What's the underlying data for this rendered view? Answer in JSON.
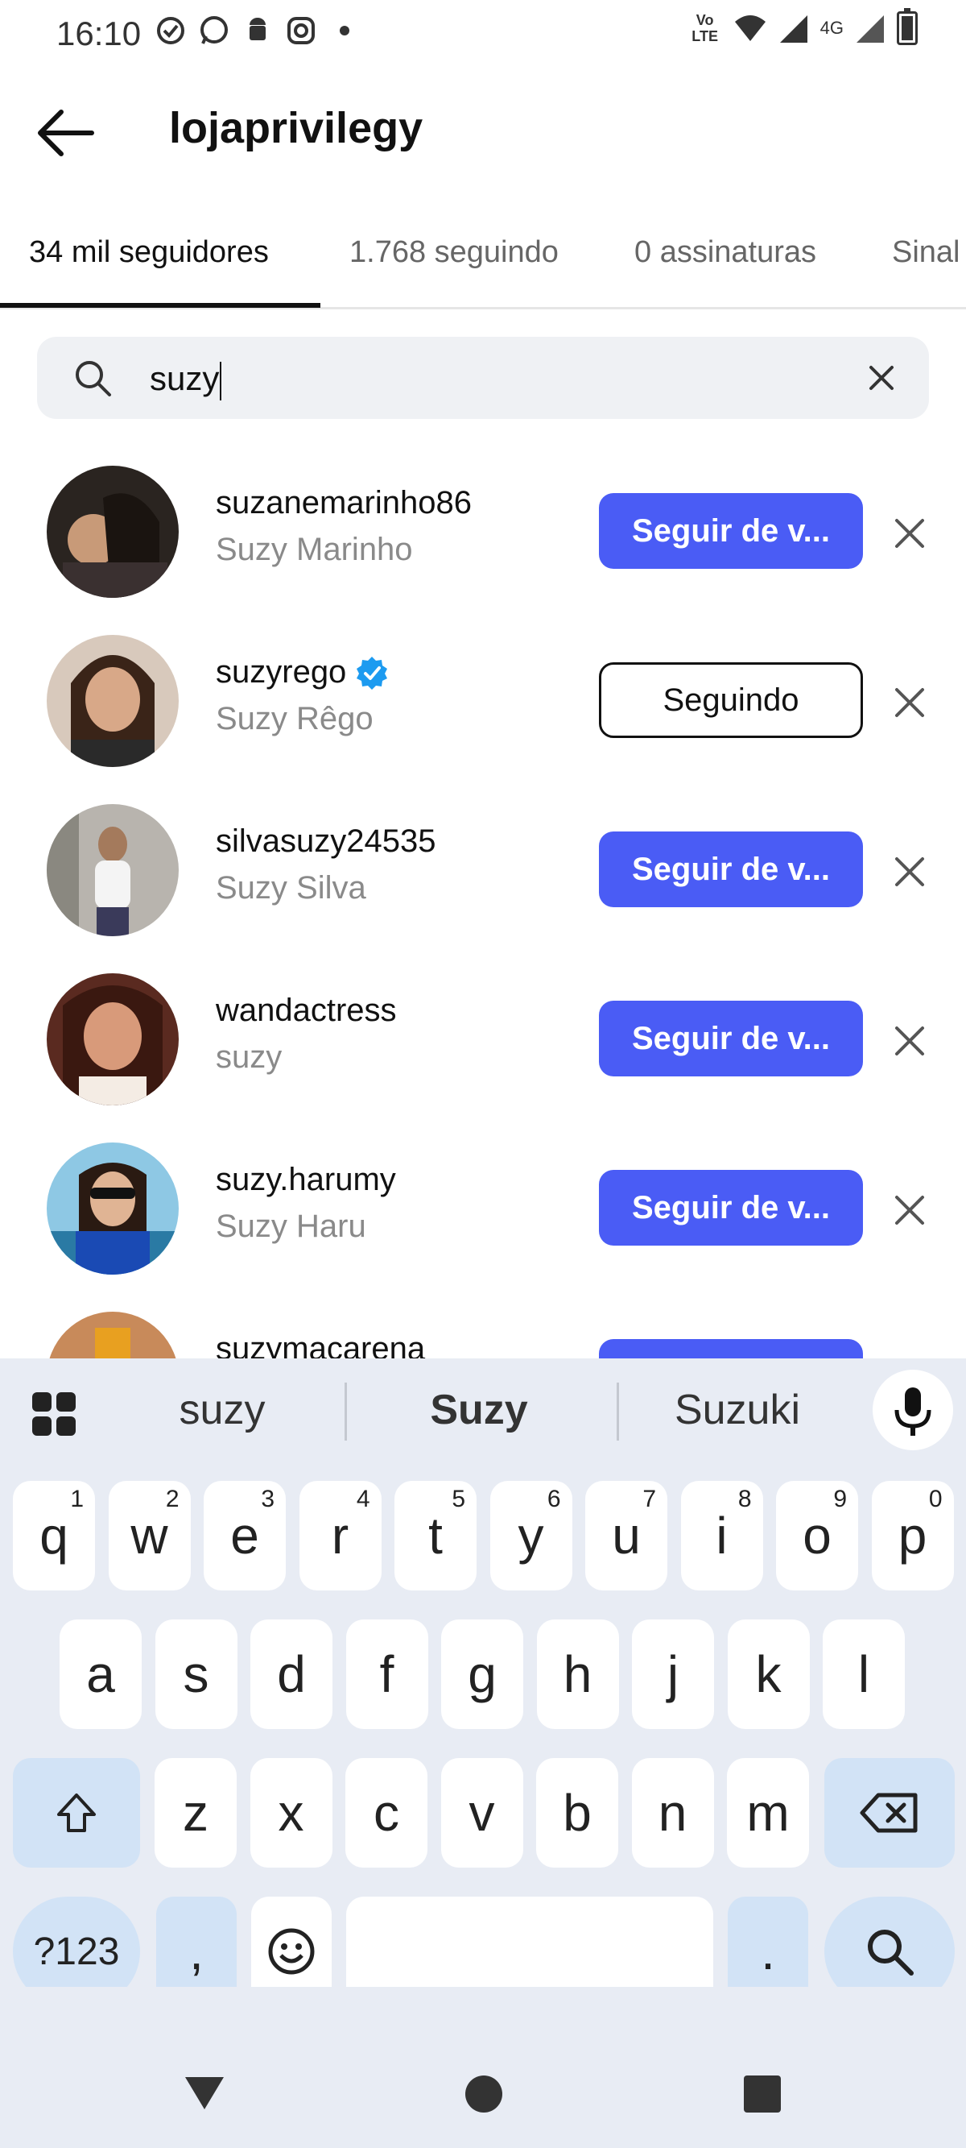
{
  "status_bar": {
    "time": "16:10",
    "volte": "Vo LTE",
    "network": "4G",
    "icons": [
      "sync-icon",
      "whatsapp-icon",
      "android-icon",
      "instagram-icon",
      "dot-icon",
      "wifi-icon",
      "signal-icon",
      "battery-icon"
    ]
  },
  "header": {
    "title": "lojaprivilegy"
  },
  "tabs": [
    {
      "label": "34 mil seguidores",
      "active": true
    },
    {
      "label": "1.768 seguindo",
      "active": false
    },
    {
      "label": "0 assinaturas",
      "active": false
    },
    {
      "label": "Sinal",
      "active": false
    }
  ],
  "search": {
    "value": "suzy"
  },
  "list": [
    {
      "username": "suzanemarinho86",
      "name": "Suzy Marinho",
      "verified": false,
      "button": "Seguir de v...",
      "following": false
    },
    {
      "username": "suzyrego",
      "name": "Suzy Rêgo",
      "verified": true,
      "button": "Seguindo",
      "following": true
    },
    {
      "username": "silvasuzy24535",
      "name": "Suzy Silva",
      "verified": false,
      "button": "Seguir de v...",
      "following": false
    },
    {
      "username": "wandactress",
      "name": "suzy",
      "verified": false,
      "button": "Seguir de v...",
      "following": false
    },
    {
      "username": "suzy.harumy",
      "name": "Suzy Haru",
      "verified": false,
      "button": "Seguir de v...",
      "following": false
    },
    {
      "username": "suzymacarena",
      "name": "",
      "verified": false,
      "button": "",
      "following": false
    }
  ],
  "keyboard": {
    "suggestions": [
      "suzy",
      "Suzy",
      "Suzuki"
    ],
    "row1": [
      {
        "k": "q",
        "n": "1"
      },
      {
        "k": "w",
        "n": "2"
      },
      {
        "k": "e",
        "n": "3"
      },
      {
        "k": "r",
        "n": "4"
      },
      {
        "k": "t",
        "n": "5"
      },
      {
        "k": "y",
        "n": "6"
      },
      {
        "k": "u",
        "n": "7"
      },
      {
        "k": "i",
        "n": "8"
      },
      {
        "k": "o",
        "n": "9"
      },
      {
        "k": "p",
        "n": "0"
      }
    ],
    "row2": [
      "a",
      "s",
      "d",
      "f",
      "g",
      "h",
      "j",
      "k",
      "l"
    ],
    "row3": [
      "z",
      "x",
      "c",
      "v",
      "b",
      "n",
      "m"
    ],
    "symbols_label": "?123",
    "comma": ",",
    "period": "."
  },
  "colors": {
    "primary_button": "#4a5cf5",
    "verified_badge": "#1d9bf0",
    "keyboard_bg": "#e8ecf4",
    "function_key": "#d2e3f6"
  }
}
